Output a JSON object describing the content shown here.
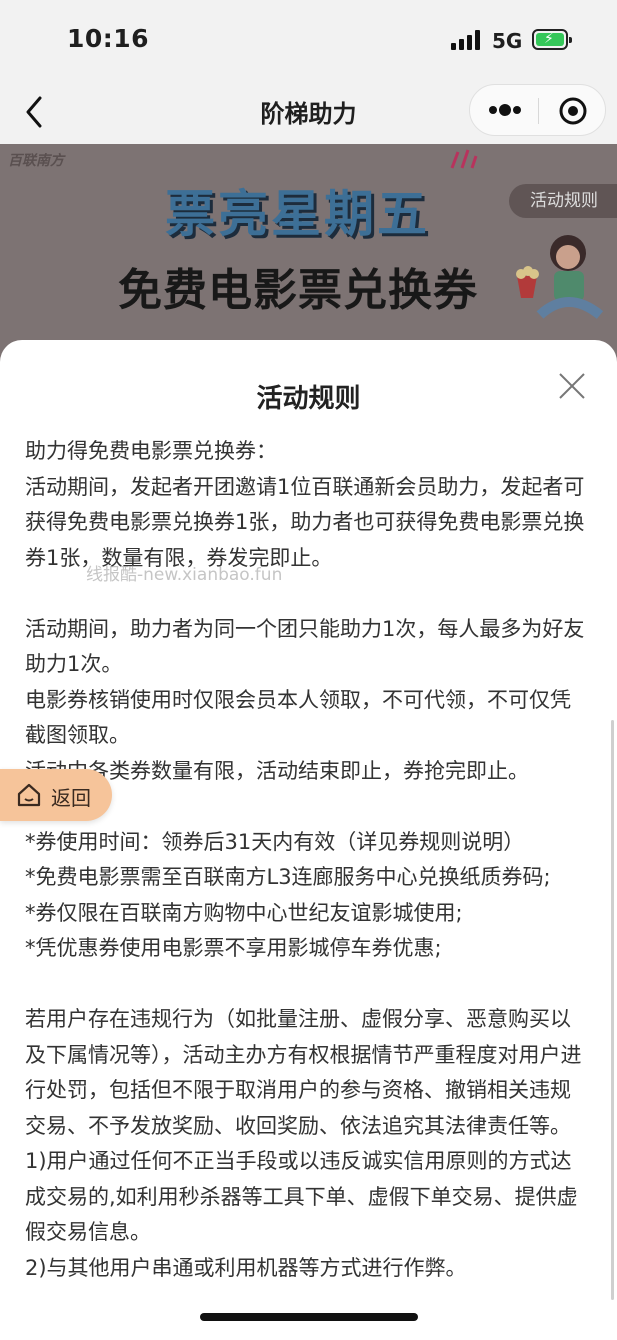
{
  "status_bar": {
    "time": "10:16",
    "network": "5G",
    "battery_color": "#35c759"
  },
  "nav": {
    "title": "阶梯助力"
  },
  "banner": {
    "brand": "百联南方",
    "headline": "票亮星期五",
    "subheadline": "免费电影票兑换券",
    "rules_button": "活动规则"
  },
  "sheet": {
    "title": "活动规则",
    "paragraphs": [
      "助力得免费电影票兑换券：",
      "活动期间，发起者开团邀请1位百联通新会员助力，发起者可获得免费电影票兑换券1张，助力者也可获得免费电影票兑换券1张，数量有限，券发完即止。",
      "",
      "活动期间，助力者为同一个团只能助力1次，每人最多为好友助力1次。",
      "电影券核销使用时仅限会员本人领取，不可代领，不可仅凭截图领取。",
      "活动中各类券数量有限，活动结束即止，券抢完即止。",
      "",
      "*券使用时间：领券后31天内有效（详见券规则说明）",
      "*免费电影票需至百联南方L3连廊服务中心兑换纸质券码;",
      "*券仅限在百联南方购物中心世纪友谊影城使用;",
      "*凭优惠券使用电影票不享用影城停车券优惠;",
      "",
      "若用户存在违规行为（如批量注册、虚假分享、恶意购买以及下属情况等），活动主办方有权根据情节严重程度对用户进行处罚，包括但不限于取消用户的参与资格、撤销相关违规交易、不予发放奖励、收回奖励、依法追究其法律责任等。",
      "1)用户通过任何不正当手段或以违反诚实信用原则的方式达成交易的,如利用秒杀器等工具下单、虚假下单交易、提供虚假交易信息。",
      "2)与其他用户串通或利用机器等方式进行作弊。"
    ],
    "watermark": "线报酷-new.xianbao.fun"
  },
  "return_button": {
    "label": "返回"
  }
}
